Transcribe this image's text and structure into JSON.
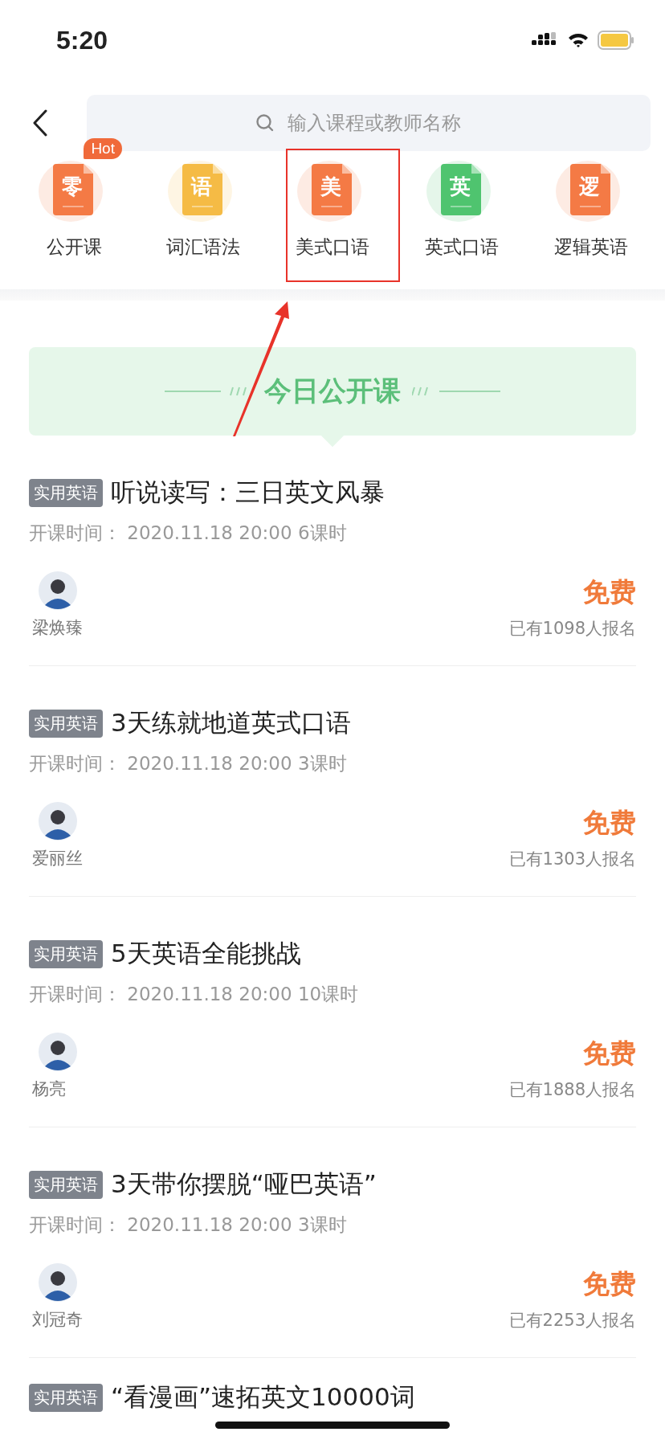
{
  "status_bar": {
    "time": "5:20"
  },
  "search": {
    "placeholder": "输入课程或教师名称"
  },
  "categories": [
    {
      "glyph": "零",
      "label": "公开课",
      "badge": "Hot",
      "color": "#f47a45"
    },
    {
      "glyph": "语",
      "label": "词汇语法",
      "color": "#f5bb45"
    },
    {
      "glyph": "美",
      "label": "美式口语",
      "color": "#f47a45"
    },
    {
      "glyph": "英",
      "label": "英式口语",
      "color": "#4fc46f"
    },
    {
      "glyph": "逻",
      "label": "逻辑英语",
      "color": "#f47a45"
    }
  ],
  "banner": {
    "title": "今日公开课"
  },
  "courses": [
    {
      "tag": "实用英语",
      "title": "听说读写：三日英文风暴",
      "meta": "开课时间：  2020.11.18 20:00 6课时",
      "teacher": "梁焕臻",
      "price": "免费",
      "enrolled": "已有1098人报名"
    },
    {
      "tag": "实用英语",
      "title": "3天练就地道英式口语",
      "meta": "开课时间：  2020.11.18 20:00 3课时",
      "teacher": "爱丽丝",
      "price": "免费",
      "enrolled": "已有1303人报名"
    },
    {
      "tag": "实用英语",
      "title": "5天英语全能挑战",
      "meta": "开课时间：  2020.11.18 20:00 10课时",
      "teacher": "杨亮",
      "price": "免费",
      "enrolled": "已有1888人报名"
    },
    {
      "tag": "实用英语",
      "title": "3天带你摆脱“哑巴英语”",
      "meta": "开课时间：  2020.11.18 20:00 3课时",
      "teacher": "刘冠奇",
      "price": "免费",
      "enrolled": "已有2253人报名"
    },
    {
      "tag": "实用英语",
      "title": "“看漫画”速拓英文10000词"
    }
  ]
}
